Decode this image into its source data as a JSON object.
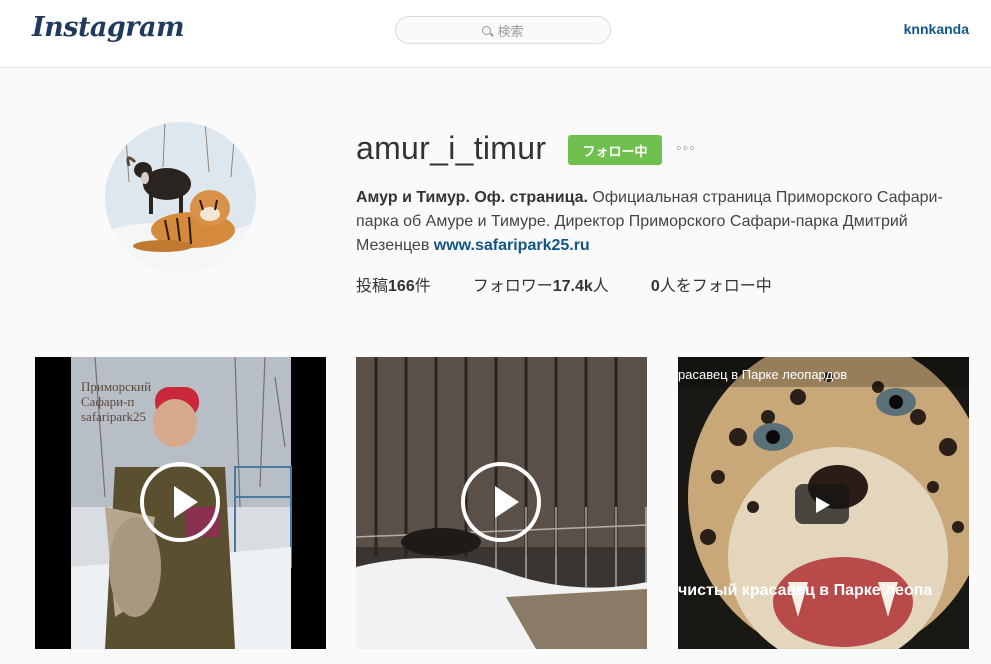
{
  "header": {
    "logo": "Instagram",
    "search_placeholder": "検索",
    "current_user": "knnkanda"
  },
  "profile": {
    "username": "amur_i_timur",
    "follow_button": "フォロー中",
    "more_button": "◦◦◦",
    "bio_name": "Амур и Тимур. Оф. страница.",
    "bio_text": " Официальная страница Приморского Сафари-парка об Амуре и Тимуре. Директор Приморского Сафари-парка Дмитрий Мезенцев ",
    "bio_link": "www.safaripark25.ru",
    "stats": {
      "posts_label": "投稿",
      "posts_value": "166",
      "posts_suffix": "件",
      "followers_label": "フォロワー",
      "followers_value": "17.4k",
      "followers_suffix": "人",
      "following_value": "0",
      "following_suffix": "人をフォロー中"
    }
  },
  "posts": [
    {
      "type": "video",
      "watermark": [
        "Приморский",
        "Сафари-п",
        "safaripark25"
      ]
    },
    {
      "type": "video"
    },
    {
      "type": "youtube",
      "title": "расавец в Парке леопардов",
      "subtitle": "чистый красавец в Парке леопа"
    }
  ],
  "colors": {
    "follow_green": "#70c050",
    "link_blue": "#125688"
  }
}
